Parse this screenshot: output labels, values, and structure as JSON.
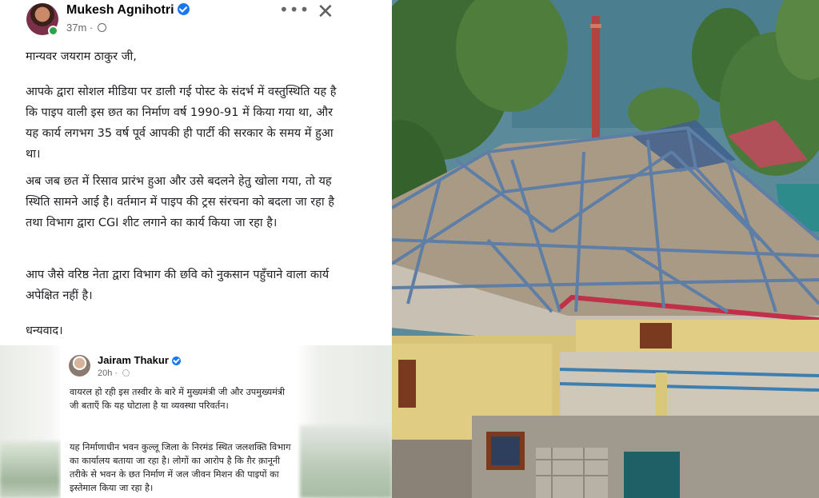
{
  "post": {
    "author": "Mukesh Agnihotri",
    "time": "37m",
    "more_icon": "more-options-icon",
    "close_icon": "close-icon",
    "greeting": "मान्यवर जयराम ठाकुर जी,",
    "para1": "आपके द्वारा सोशल मीडिया पर डाली गई पोस्ट के संदर्भ में वस्तुस्थिति यह है कि पाइप वाली इस छत का निर्माण वर्ष 1990-91 में किया गया था, और यह कार्य लगभग 35 वर्ष पूर्व आपकी ही पार्टी की सरकार के समय में हुआ था।",
    "para2": "अब जब छत में रिसाव प्रारंभ हुआ और उसे बदलने हेतु खोला गया, तो यह स्थिति सामने आई है। वर्तमान में पाइप की ट्रस संरचना को बदला जा रहा है तथा विभाग द्वारा CGI शीट लगाने का कार्य किया जा रहा है।",
    "para3": "आप जैसे वरिष्ठ नेता द्वारा विभाग की छवि को नुकसान पहुँचाने वाला कार्य अपेक्षित नहीं है।",
    "thanks": "धन्यवाद।"
  },
  "embedded_post": {
    "author": "Jairam Thakur",
    "time": "20h",
    "para1": "वायरल हो रही इस तस्वीर के बारे में मुख्यमंत्री जी और उपमुख्यमंत्री जी बताएँ कि यह घोटाला है या व्यवस्था परिवर्तन।",
    "para2": "यह निर्माणाधीन भवन कुल्लू जिला के निरमंड स्थित जलशक्ति विभाग का कार्यालय बताया जा रहा है। लोगों का आरोप है कि ग़ैर क़ानूनी तरीके से भवन के छत निर्माण में जल जीवन मिशन की पाइपों का इस्तेमाल किया जा रहा है।"
  },
  "colors": {
    "verified": "#1877f2",
    "online": "#31a24c",
    "meta": "#65676b"
  }
}
